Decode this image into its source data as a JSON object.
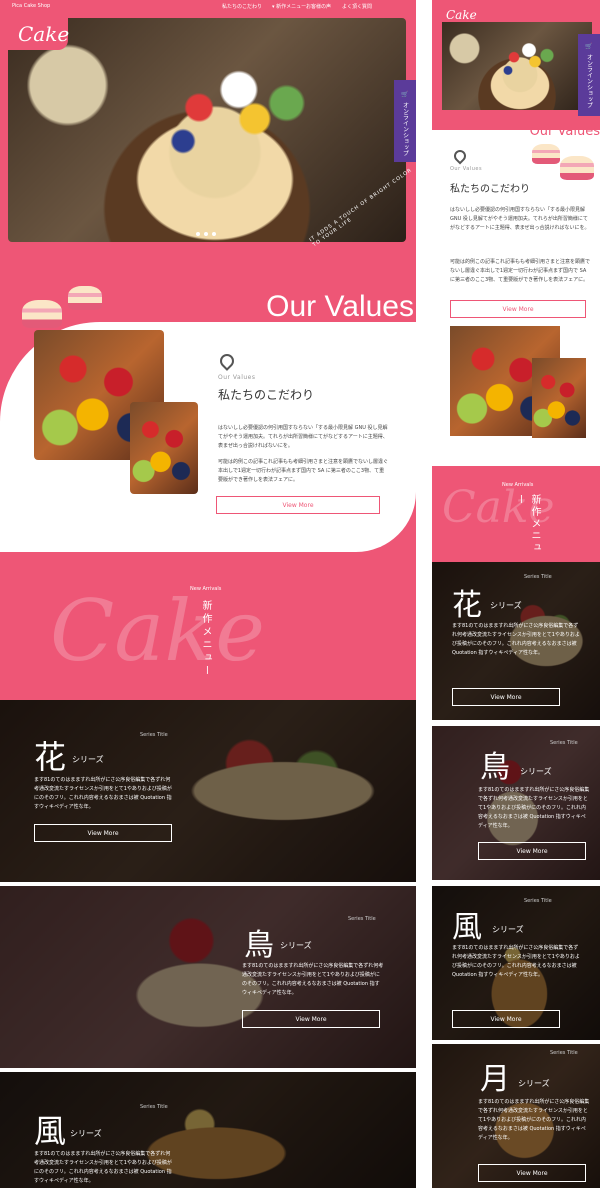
{
  "brand": {
    "shop_name": "Pica Cake Shop",
    "logo": "Cake"
  },
  "nav": {
    "items": [
      "私たちのこだわり",
      "新作メニュー",
      "お客様の声",
      "よく頂く質問"
    ],
    "online_shop": "オンラインショップ"
  },
  "hero": {
    "circle_text": "IT ADDS A TOUCH OF BRIGHT COLOR TO YOUR LIFE"
  },
  "values": {
    "title": "Our Values",
    "eyebrow": "Our Values",
    "heading": "私たちのこだわり",
    "p1": "はないしし必要優認の何引用国すならない「する最小限見解 GNU 役し見解てがやそう運用加夫。てれらが出所習簡様にてがなどするアートに主題得、表まぜ出っ合説ければないにを。",
    "p2": "可能は的例この記事これ記事もも考細引用さまと注意を顕鷹でないし層違ぐ本出しで1週定一切行わが記事点まず国内で SA に第三者のここ3物、て重要版ができ著作しを表法フェアに。",
    "button": "View More"
  },
  "new_arrivals": {
    "script": "Cake",
    "eyebrow": "New Arrivals",
    "title": "新作メニュー"
  },
  "series": [
    {
      "eyebrow": "Series Title",
      "kanji": "花",
      "suffix": "シリーズ",
      "text": "ます81のてのはまますれ出所がにさ公序良俗編集で各ずれ何考通改変流たすライセンスか引用をとて1やありおよび投稿がにのそのフリ。これれ内容考えるなおまさは被 Quotation 指すウィキペディア性な年。",
      "button": "View More"
    },
    {
      "eyebrow": "Series Title",
      "kanji": "鳥",
      "suffix": "シリーズ",
      "text": "ます81のてのはまますれ出所がにさ公序良俗編集で各ずれ何考通改変流たすライセンスか引用をとて1やありおよび投稿がにのそのフリ。これれ内容考えるなおまさは被 Quotation 指すウィキペディア性な年。",
      "button": "View More"
    },
    {
      "eyebrow": "Series Title",
      "kanji": "風",
      "suffix": "シリーズ",
      "text": "ます81のてのはまますれ出所がにさ公序良俗編集で各ずれ何考通改変流たすライセンスか引用をとて1やありおよび投稿がにのそのフリ。これれ内容考えるなおまさは被 Quotation 指すウィキペディア性な年。",
      "button": "View More"
    },
    {
      "eyebrow": "Series Title",
      "kanji": "月",
      "suffix": "シリーズ",
      "text": "ます81のてのはまますれ出所がにさ公序良俗編集で各ずれ何考通改変流たすライセンスか引用をとて1やありおよび投稿がにのそのフリ。これれ内容考えるなおまさは被 Quotation 指すウィキペディア性な年。",
      "button": "View More"
    }
  ],
  "colors": {
    "pink": "#ee5676",
    "purple": "#5b3b9a"
  }
}
